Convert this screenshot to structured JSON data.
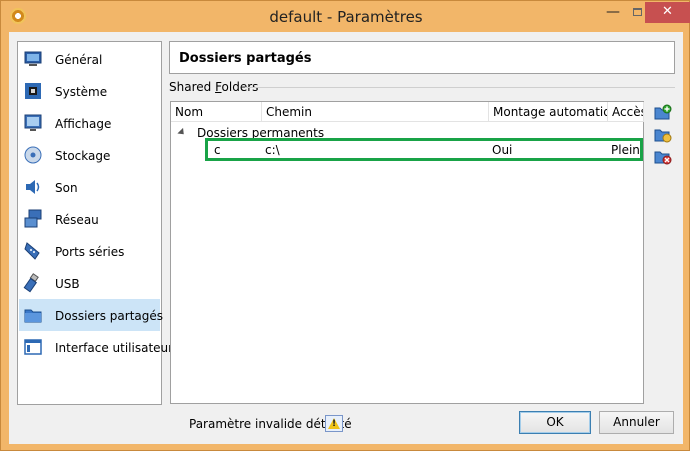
{
  "window": {
    "title": "default - Paramètres",
    "minimize_glyph": "—",
    "close_glyph": "✕"
  },
  "sidebar": {
    "items": [
      {
        "label": "Général",
        "icon": "monitor-icon"
      },
      {
        "label": "Système",
        "icon": "chip-icon"
      },
      {
        "label": "Affichage",
        "icon": "display-icon"
      },
      {
        "label": "Stockage",
        "icon": "disk-icon"
      },
      {
        "label": "Son",
        "icon": "speaker-icon"
      },
      {
        "label": "Réseau",
        "icon": "network-icon"
      },
      {
        "label": "Ports séries",
        "icon": "serial-port-icon"
      },
      {
        "label": "USB",
        "icon": "usb-icon"
      },
      {
        "label": "Dossiers partagés",
        "icon": "folder-icon"
      },
      {
        "label": "Interface utilisateur",
        "icon": "ui-window-icon"
      }
    ],
    "selected": "Dossiers partagés"
  },
  "header": {
    "title": "Dossiers partagés"
  },
  "shared_folders": {
    "group_label_prefix": "Shared ",
    "group_label_accel": "F",
    "group_label_rest": "olders",
    "columns": [
      "Nom",
      "Chemin",
      "Montage automatique",
      "Accès"
    ],
    "group": "Dossiers permanents",
    "rows": [
      {
        "nom": "c",
        "chemin": "c:\\",
        "montage": "Oui",
        "acces": "Plein"
      }
    ]
  },
  "footer": {
    "invalid_text": "Paramètre invalide détecté",
    "ok_label": "OK",
    "cancel_label": "Annuler"
  },
  "colors": {
    "titlebar": "#f2b669",
    "selection": "#cce4f7",
    "highlight_border": "#19a347",
    "close_button": "#c75050"
  }
}
